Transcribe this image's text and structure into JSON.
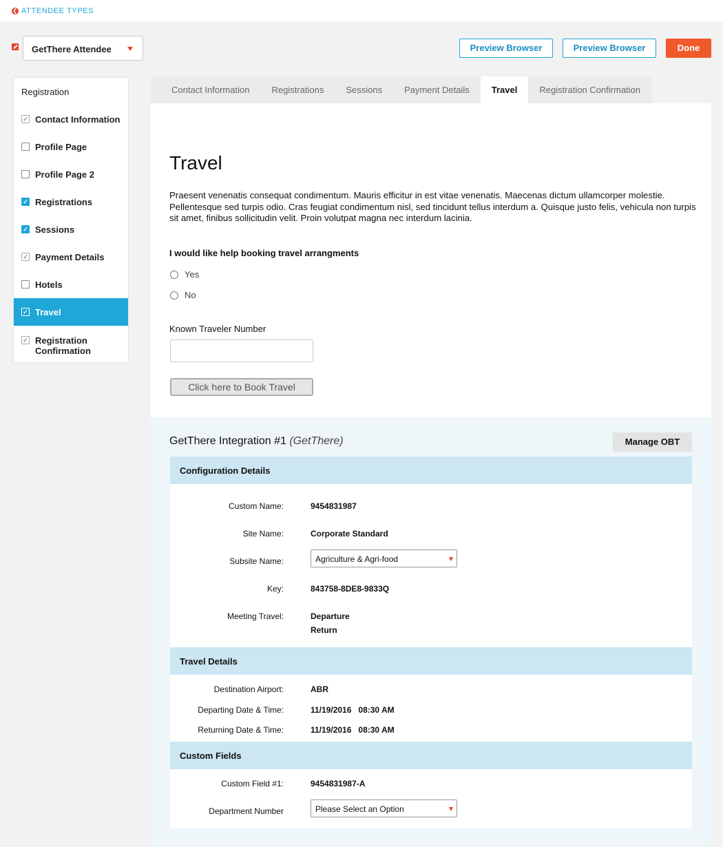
{
  "header": {
    "back_label": "ATTENDEE TYPES",
    "attendee_type": "GetThere Attendee",
    "preview_label_1": "Preview Browser",
    "preview_label_2": "Preview Browser",
    "done_label": "Done"
  },
  "sidebar": {
    "title": "Registration",
    "items": [
      {
        "label": "Contact Information",
        "state": "grey"
      },
      {
        "label": "Profile Page",
        "state": "empty"
      },
      {
        "label": "Profile Page 2",
        "state": "empty"
      },
      {
        "label": "Registrations",
        "state": "blue"
      },
      {
        "label": "Sessions",
        "state": "blue"
      },
      {
        "label": "Payment Details",
        "state": "grey"
      },
      {
        "label": "Hotels",
        "state": "empty"
      },
      {
        "label": "Travel",
        "state": "active"
      },
      {
        "label": "Registration Confirmation",
        "state": "grey"
      }
    ]
  },
  "tabs": [
    {
      "label": "Contact Information"
    },
    {
      "label": "Registrations"
    },
    {
      "label": "Sessions"
    },
    {
      "label": "Payment Details"
    },
    {
      "label": "Travel"
    },
    {
      "label": "Registration Confirmation"
    }
  ],
  "content": {
    "title": "Travel",
    "intro": "Praesent venenatis consequat condimentum. Mauris efficitur in est vitae venenatis. Maecenas dictum ullamcorper molestie. Pellentesque sed turpis odio. Cras feugiat condimentum nisl, sed tincidunt tellus interdum a. Quisque justo felis, vehicula non turpis sit amet, finibus sollicitudin velit. Proin volutpat magna nec interdum lacinia.",
    "question": "I would like help booking travel arrangments",
    "option_yes": "Yes",
    "option_no": "No",
    "ktn_label": "Known Traveler Number",
    "ktn_value": "",
    "book_button": "Click here to Book Travel"
  },
  "integration": {
    "title": "GetThere Integration #1",
    "subtitle": "(GetThere)",
    "manage_button": "Manage OBT",
    "config": {
      "heading": "Configuration Details",
      "custom_name_label": "Custom Name:",
      "custom_name": "9454831987",
      "site_name_label": "Site Name:",
      "site_name": "Corporate Standard",
      "subsite_label": "Subsite Name:",
      "subsite_value": "Agriculture & Agri-food",
      "key_label": "Key:",
      "key": "843758-8DE8-9833Q",
      "meeting_travel_label": "Meeting Travel:",
      "departure": "Departure",
      "return": "Return"
    },
    "travel": {
      "heading": "Travel Details",
      "destination_label": "Destination Airport:",
      "destination": "ABR",
      "departing_label": "Departing Date & Time:",
      "departing": "11/19/2016   08:30 AM",
      "returning_label": "Returning Date & Time:",
      "returning": "11/19/2016   08:30 AM"
    },
    "custom": {
      "heading": "Custom Fields",
      "field1_label": "Custom Field #1:",
      "field1": "9454831987-A",
      "department_label": "Department Number",
      "department_value": "Please Select an Option"
    }
  },
  "colors": {
    "accent": "#1ea7d8",
    "done": "#f05a2b",
    "caret": "#e8432f",
    "section_header": "#cce6f3",
    "integration_bg": "#eef6fa"
  }
}
